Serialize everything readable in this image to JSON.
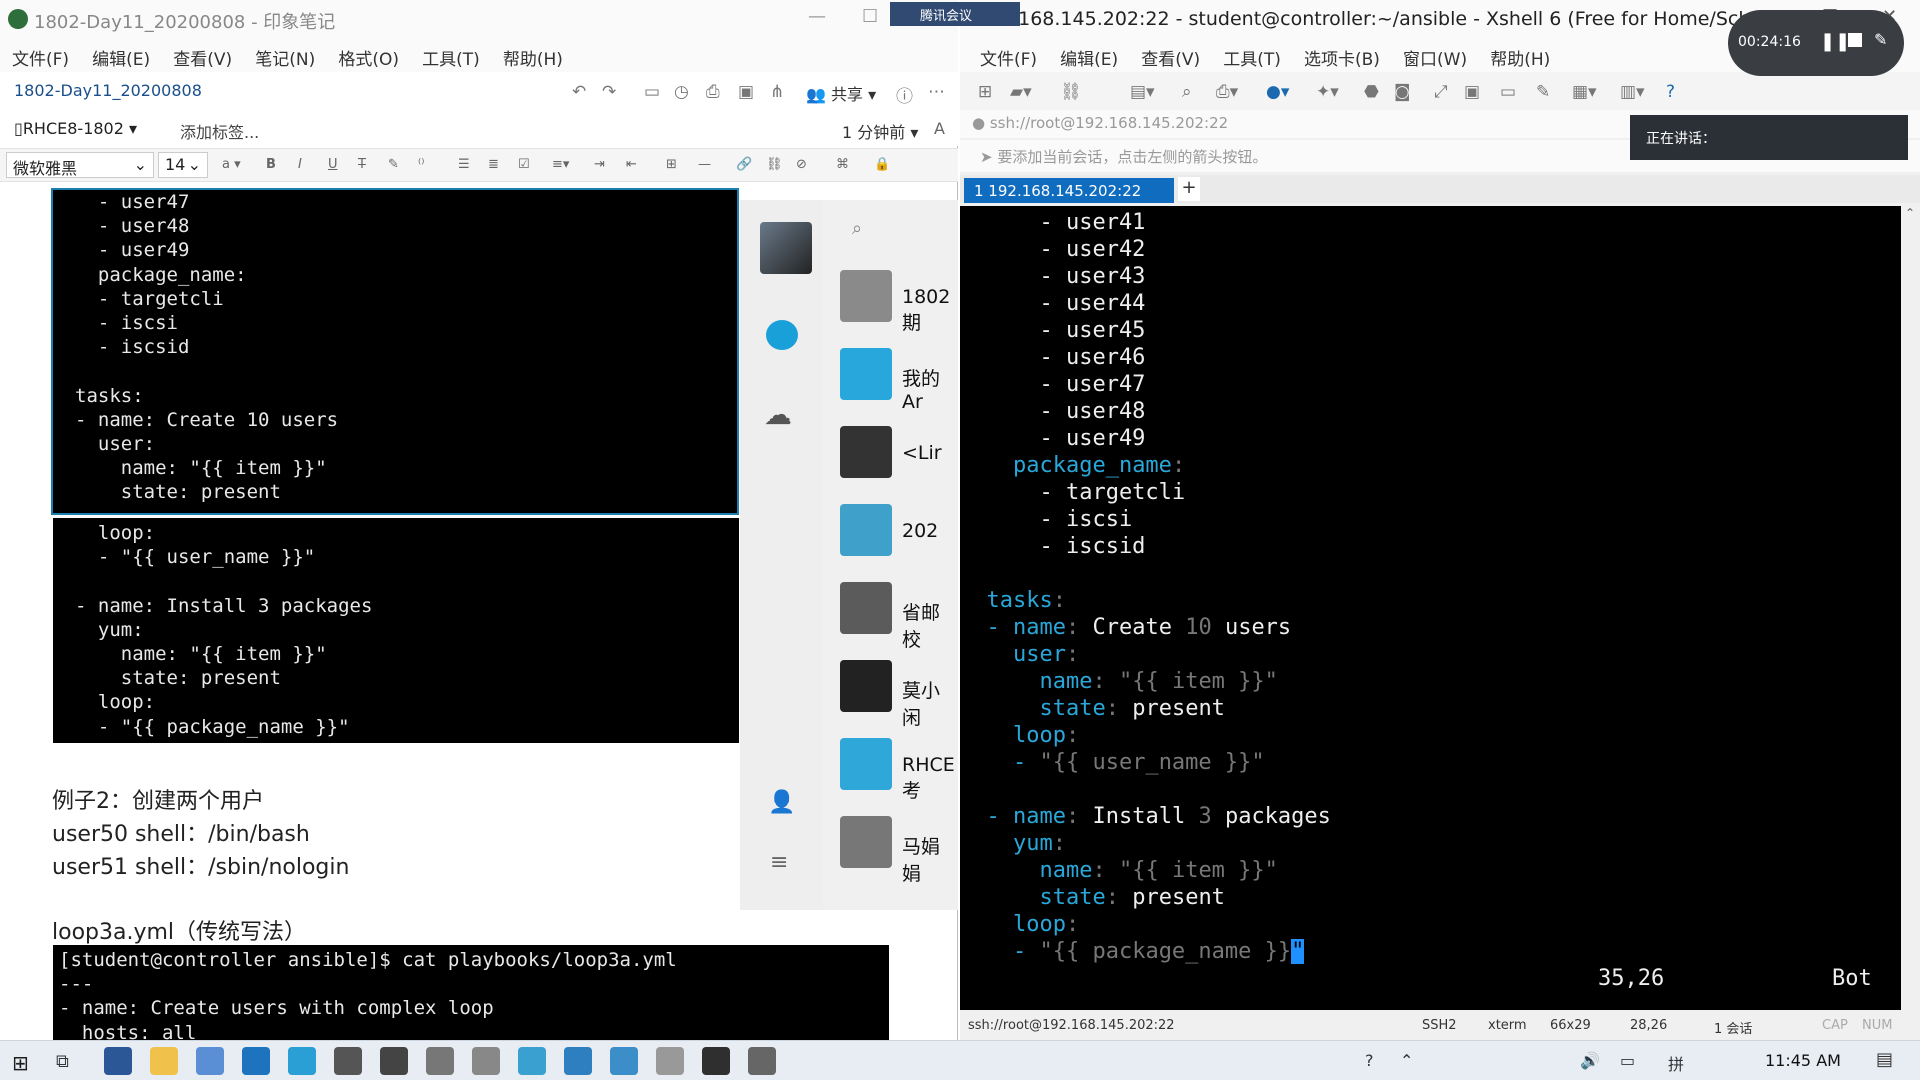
{
  "evernote": {
    "window_title": "1802-Day11_20200808 - 印象笔记",
    "menu": [
      "文件(F)",
      "编辑(E)",
      "查看(V)",
      "笔记(N)",
      "格式(O)",
      "工具(T)",
      "帮助(H)"
    ],
    "note_title": "1802-Day11_20200808",
    "share_label": "共享",
    "notebook": "RHCE8-1802",
    "add_tag": "添加标签...",
    "time_ago": "1 分钟前",
    "font_family": "微软雅黑",
    "font_size": "14",
    "code_block_1": "  - user47\n  - user48\n  - user49\n  package_name:\n  - targetcli\n  - iscsi\n  - iscsid\n\ntasks:\n- name: Create 10 users\n  user:\n    name: \"{{ item }}\"\n    state: present",
    "code_block_2": "  loop:\n  - \"{{ user_name }}\"\n\n- name: Install 3 packages\n  yum:\n    name: \"{{ item }}\"\n    state: present\n  loop:\n  - \"{{ package_name }}\"",
    "example_heading": "例子2：创建两个用户",
    "example_line1": "user50 shell：/bin/bash",
    "example_line2": "user51 shell：/sbin/nologin",
    "loop_file_heading": "loop3a.yml（传统写法）",
    "code_block_3": "[student@controller ansible]$ cat playbooks/loop3a.yml\n---\n- name: Create users with complex loop\n  hosts: all"
  },
  "chat_panel": {
    "chats": [
      "1802期",
      "我的Ar",
      "<Lir",
      "202",
      "省邮校",
      "莫小闲",
      "RHCE考",
      "马娟娟"
    ]
  },
  "xshell": {
    "window_title": "2.168.145.202:22 - student@controller:~/ansible - Xshell 6 (Free for Home/School)",
    "menu": [
      "文件(F)",
      "编辑(E)",
      "查看(V)",
      "工具(T)",
      "选项卡(B)",
      "窗口(W)",
      "帮助(H)"
    ],
    "address": "ssh://root@192.168.145.202:22",
    "notice": "要添加当前会话，点击左侧的箭头按钮。",
    "tab_label": "1 192.168.145.202:22",
    "cursor_pos": "35,26",
    "scroll_pos": "Bot",
    "status": {
      "address": "ssh://root@192.168.145.202:22",
      "protocol": "SSH2",
      "term": "xterm",
      "size": "66x29",
      "cursor": "28,26",
      "sessions": "1 会话",
      "cap": "CAP",
      "num": "NUM"
    }
  },
  "meeting": {
    "tag": "腾讯会议",
    "timer": "00:24:16",
    "speaking_label": "正在讲话："
  },
  "taskbar": {
    "clock": "11:45 AM"
  }
}
